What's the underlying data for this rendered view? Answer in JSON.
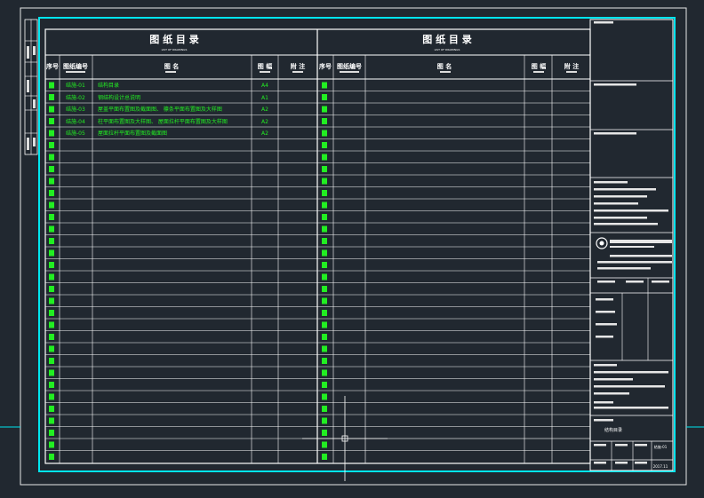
{
  "drawing_index": {
    "left_title": "图 纸 目 录",
    "right_title": "图 纸 目 录",
    "subtitle": "LIST OF DRAWINGS",
    "columns": {
      "no": "序号",
      "drawing_no": "图纸编号",
      "name": "图 名",
      "size": "图 幅",
      "remark": "附 注"
    },
    "entries": [
      {
        "code": "结施-01",
        "name": "结构目录",
        "size": "A4"
      },
      {
        "code": "结施-02",
        "name": "钢结构设计总说明",
        "size": "A1"
      },
      {
        "code": "结施-03",
        "name": "屋盖平面布置图及截面图、 檩条平面布置图及大样图",
        "size": "A2"
      },
      {
        "code": "结施-04",
        "name": "柱平面布置图及大样图、 屋面拉杆平面布置图及大样图",
        "size": "A2"
      },
      {
        "code": "结施-05",
        "name": "屋面拉杆平面布置图及截面图",
        "size": "A2"
      }
    ]
  },
  "title_block": {
    "bottom_caption": "结构目录",
    "sheet_code_1": "结施-01",
    "sheet_code_2": "2017.11"
  },
  "colors": {
    "background": "#212830",
    "frame": "#00e5ee",
    "line": "#ffffff",
    "highlight": "#22ee22"
  }
}
